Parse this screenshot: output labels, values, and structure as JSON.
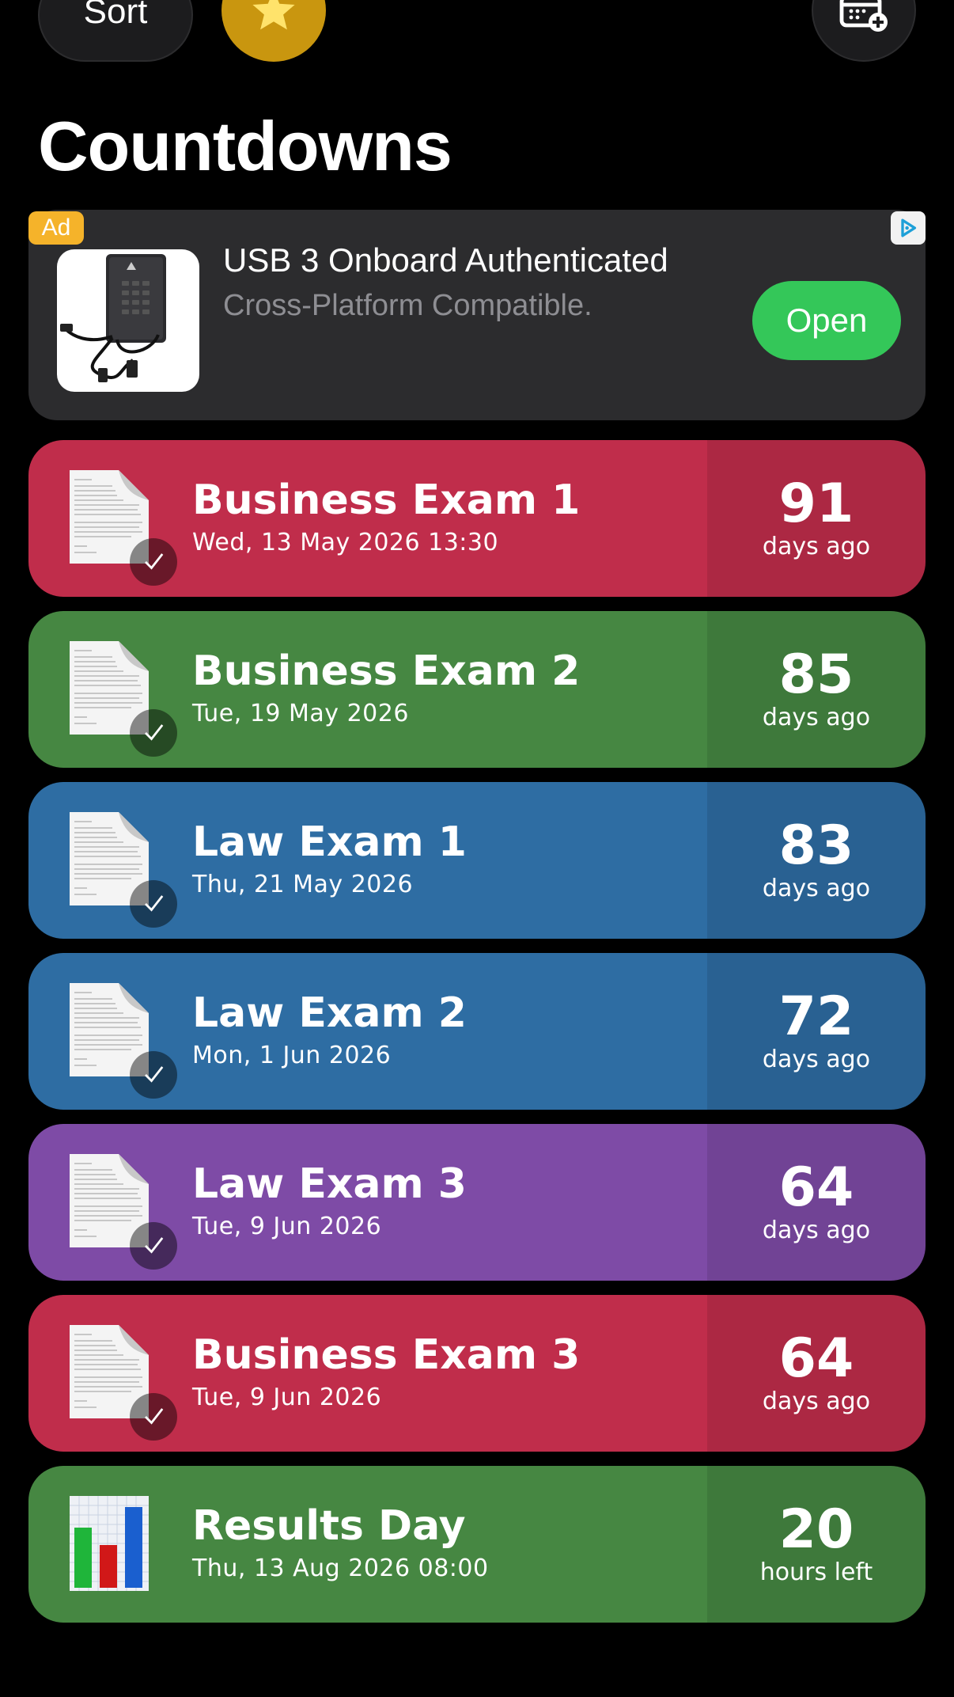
{
  "toolbar": {
    "sort_label": "Sort",
    "favorite_icon": "star-icon",
    "add_icon": "calendar-add-icon"
  },
  "page": {
    "title": "Countdowns"
  },
  "ad": {
    "badge": "Ad",
    "title": "USB 3 Onboard Authenticated",
    "subtitle": "Cross-Platform Compatible.",
    "button": "Open",
    "choices_icon": "ad-choices-icon"
  },
  "countdowns": [
    {
      "title": "Business Exam 1",
      "date": "Wed, 13 May 2026 13:30",
      "value": "91",
      "unit": "days ago",
      "color": "#c02d4b",
      "icon": "document-icon",
      "completed": true
    },
    {
      "title": "Business Exam 2",
      "date": "Tue, 19 May 2026",
      "value": "85",
      "unit": "days ago",
      "color": "#468742",
      "icon": "document-icon",
      "completed": true
    },
    {
      "title": "Law Exam 1",
      "date": "Thu, 21 May 2026",
      "value": "83",
      "unit": "days ago",
      "color": "#2e6da3",
      "icon": "document-icon",
      "completed": true
    },
    {
      "title": "Law Exam 2",
      "date": "Mon, 1 Jun 2026",
      "value": "72",
      "unit": "days ago",
      "color": "#2e6da3",
      "icon": "document-icon",
      "completed": true
    },
    {
      "title": "Law Exam 3",
      "date": "Tue, 9 Jun 2026",
      "value": "64",
      "unit": "days ago",
      "color": "#7e4ba6",
      "icon": "document-icon",
      "completed": true
    },
    {
      "title": "Business Exam 3",
      "date": "Tue, 9 Jun 2026",
      "value": "64",
      "unit": "days ago",
      "color": "#c02d4b",
      "icon": "document-icon",
      "completed": true
    },
    {
      "title": "Results Day",
      "date": "Thu, 13 Aug 2026 08:00",
      "value": "20",
      "unit": "hours left",
      "color": "#468742",
      "icon": "bar-chart-icon",
      "completed": false
    }
  ]
}
